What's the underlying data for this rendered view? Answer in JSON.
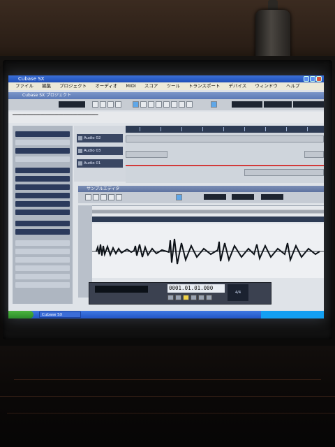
{
  "app": {
    "window_title": "Cubase SX",
    "project_title": "Cubase SX プロジェクト",
    "menu": [
      "ファイル",
      "編集",
      "プロジェクト",
      "オーディオ",
      "MIDI",
      "スコア",
      "ツール",
      "トランスポート",
      "デバイス",
      "ウィンドウ",
      "ヘルプ"
    ]
  },
  "tracks": [
    "Audio 02",
    "Audio 03",
    "Audio 01"
  ],
  "editor": {
    "title": "サンプルエディタ"
  },
  "transport": {
    "counter_main": "0001.01.01.000",
    "tempo": "4/4"
  },
  "taskbar": {
    "task_label": "Cubase SX"
  }
}
